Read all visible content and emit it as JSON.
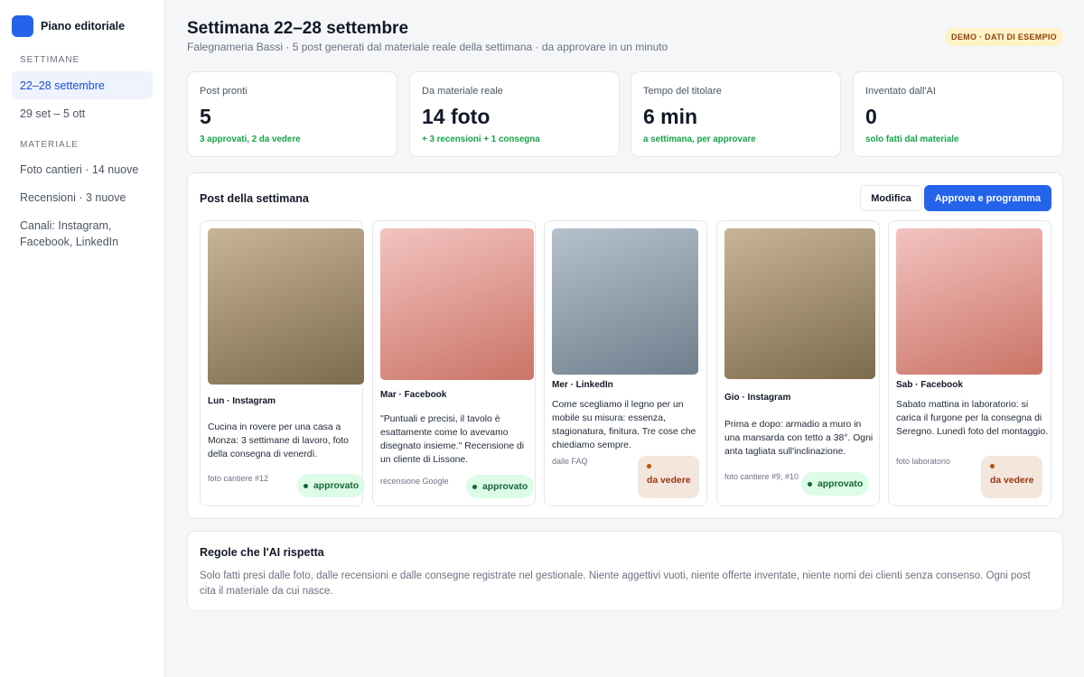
{
  "sidebar": {
    "app_name": "Piano editoriale",
    "section_weeks": "SETTIMANE",
    "weeks": [
      "22–28 settembre",
      "29 set – 5 ott"
    ],
    "section_material": "MATERIALE",
    "material": [
      "Foto cantieri · 14 nuove",
      "Recensioni · 3 nuove",
      "Canali: Instagram, Facebook, LinkedIn"
    ]
  },
  "header": {
    "title": "Settimana 22–28 settembre",
    "subtitle": "Falegnameria Bassi · 5 post generati dal materiale reale della settimana · da approvare in un minuto",
    "badge": "DEMO · DATI DI ESEMPIO"
  },
  "stats": [
    {
      "label": "Post pronti",
      "value": "5",
      "note": "3 approvati, 2 da vedere"
    },
    {
      "label": "Da materiale reale",
      "value": "14 foto",
      "note": "+ 3 recensioni + 1 consegna"
    },
    {
      "label": "Tempo del titolare",
      "value": "6 min",
      "note": "a settimana, per approvare"
    },
    {
      "label": "Inventato dall'AI",
      "value": "0",
      "note": "solo fatti dal materiale"
    }
  ],
  "posts_panel": {
    "title": "Post della settimana",
    "edit_label": "Modifica",
    "approve_label": "Approva e programma"
  },
  "posts": [
    {
      "meta": "Lun · Instagram",
      "text": "Cucina in rovere per una casa a Monza: 3 settimane di lavoro, foto della consegna di venerdì.",
      "source": "foto cantiere #12",
      "status": "approvato"
    },
    {
      "meta": "Mar · Facebook",
      "text": "\"Puntuali e precisi, il tavolo è esattamente come lo avevamo disegnato insieme.\" Recensione di un cliente di Lissone.",
      "source": "recensione Google",
      "status": "approvato"
    },
    {
      "meta": "Mer · LinkedIn",
      "text": "Come scegliamo il legno per un mobile su misura: essenza, stagionatura, finitura. Tre cose che chiediamo sempre.",
      "source": "dalle FAQ",
      "status": "da vedere"
    },
    {
      "meta": "Gio · Instagram",
      "text": "Prima e dopo: armadio a muro in una mansarda con tetto a 38°. Ogni anta tagliata sull'inclinazione.",
      "source": "foto cantiere #9, #10",
      "status": "approvato"
    },
    {
      "meta": "Sab · Facebook",
      "text": "Sabato mattina in laboratorio: si carica il furgone per la consegna di Seregno. Lunedì foto del montaggio.",
      "source": "foto laboratorio",
      "status": "da vedere"
    }
  ],
  "rules": {
    "title": "Regole che l'AI rispetta",
    "text": "Solo fatti presi dalle foto, dalle recensioni e dalle consegne registrate nel gestionale. Niente aggettivi vuoti, niente offerte inventate, niente nomi dei clienti senza consenso. Ogni post cita il materiale da cui nasce."
  },
  "colors": {
    "accent": "#2563eb",
    "success": "#16a34a",
    "approved_bg": "#dcfce7",
    "review_bg": "#f3e6dc",
    "badge_bg": "#fef3c7"
  }
}
